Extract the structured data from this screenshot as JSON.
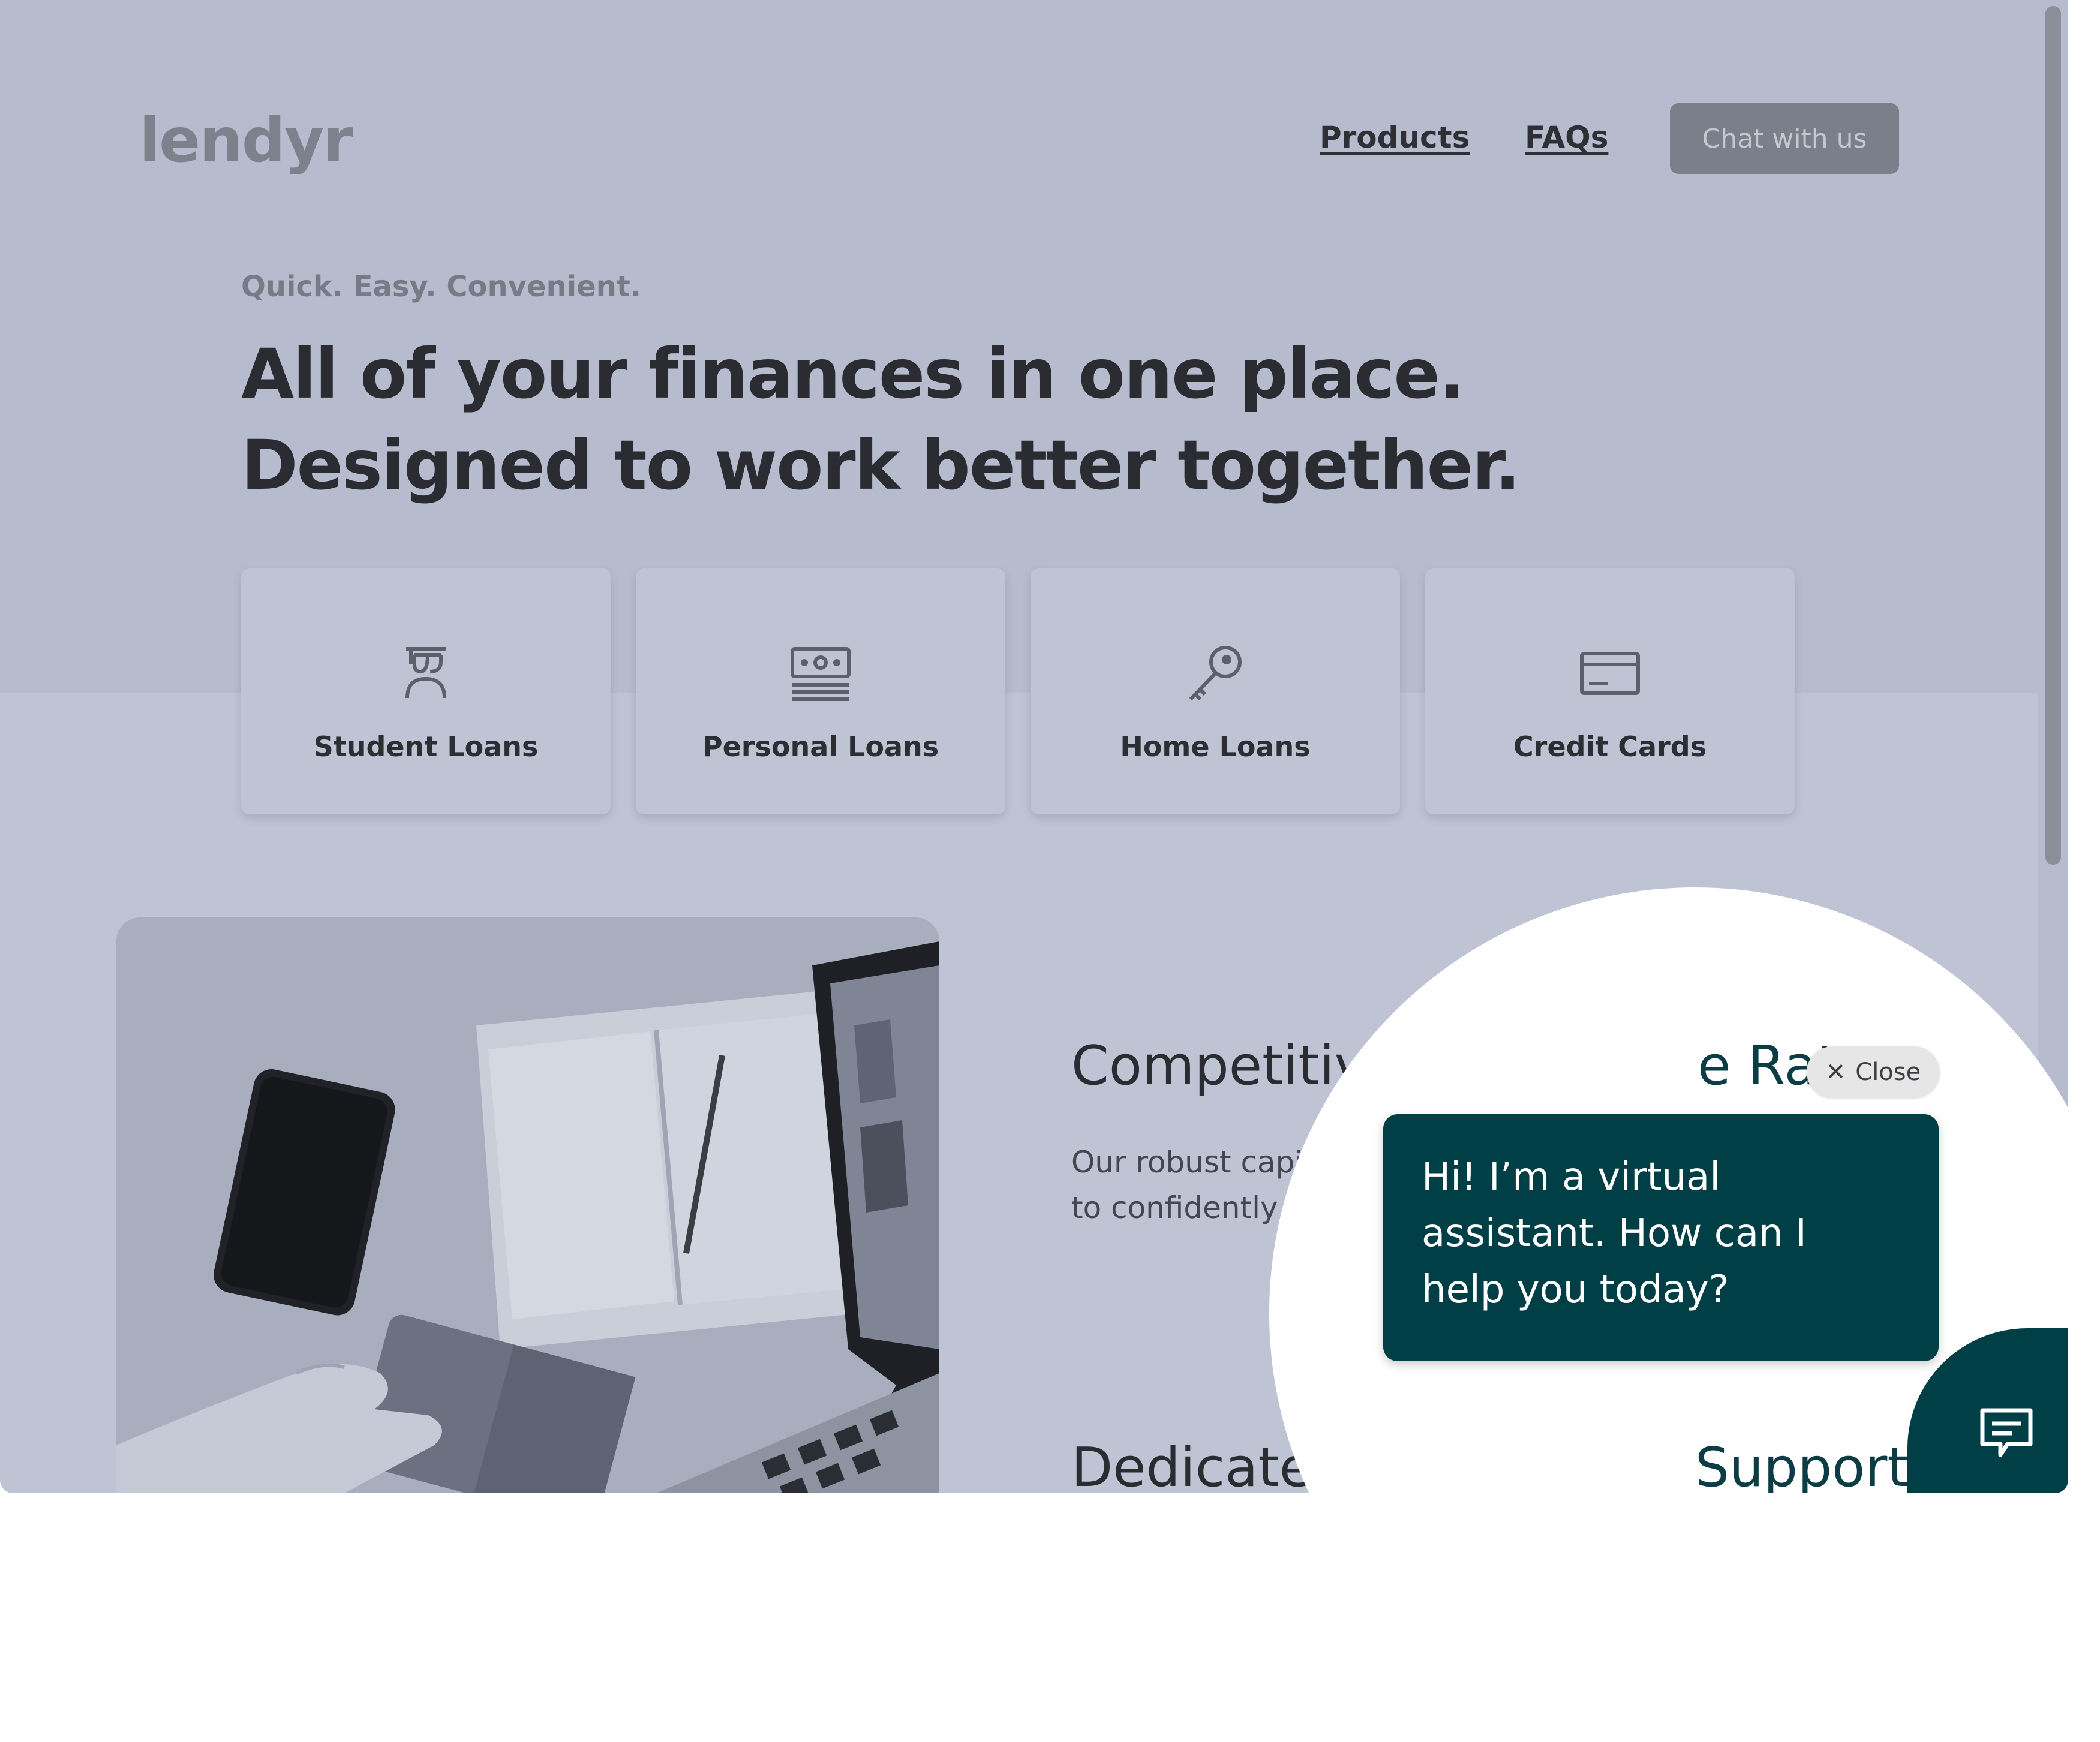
{
  "header": {
    "logo": "lendyr",
    "nav": {
      "products": "Products",
      "faqs": "FAQs"
    },
    "chat_button": "Chat with us"
  },
  "hero": {
    "eyebrow": "Quick. Easy. Convenient.",
    "headline_line1": "All of your finances in one place.",
    "headline_line2": "Designed to work better together."
  },
  "products": [
    {
      "label": "Student Loans",
      "icon": "graduate-icon"
    },
    {
      "label": "Personal Loans",
      "icon": "cash-icon"
    },
    {
      "label": "Home Loans",
      "icon": "key-icon"
    },
    {
      "label": "Credit Cards",
      "icon": "credit-card-icon"
    }
  ],
  "features": {
    "rates_title": "Competitive Rates",
    "rates_text_line1": "Our robust capital, lo",
    "rates_text_line2": "to confidently make c",
    "support_title": "Dedicated Support"
  },
  "assistant": {
    "close_label": "Close",
    "greeting": "Hi! I’m a virtual assistant. How can I help you today?"
  },
  "colors": {
    "overlay": "#bec4d4",
    "assistant_brand": "#003f45"
  }
}
